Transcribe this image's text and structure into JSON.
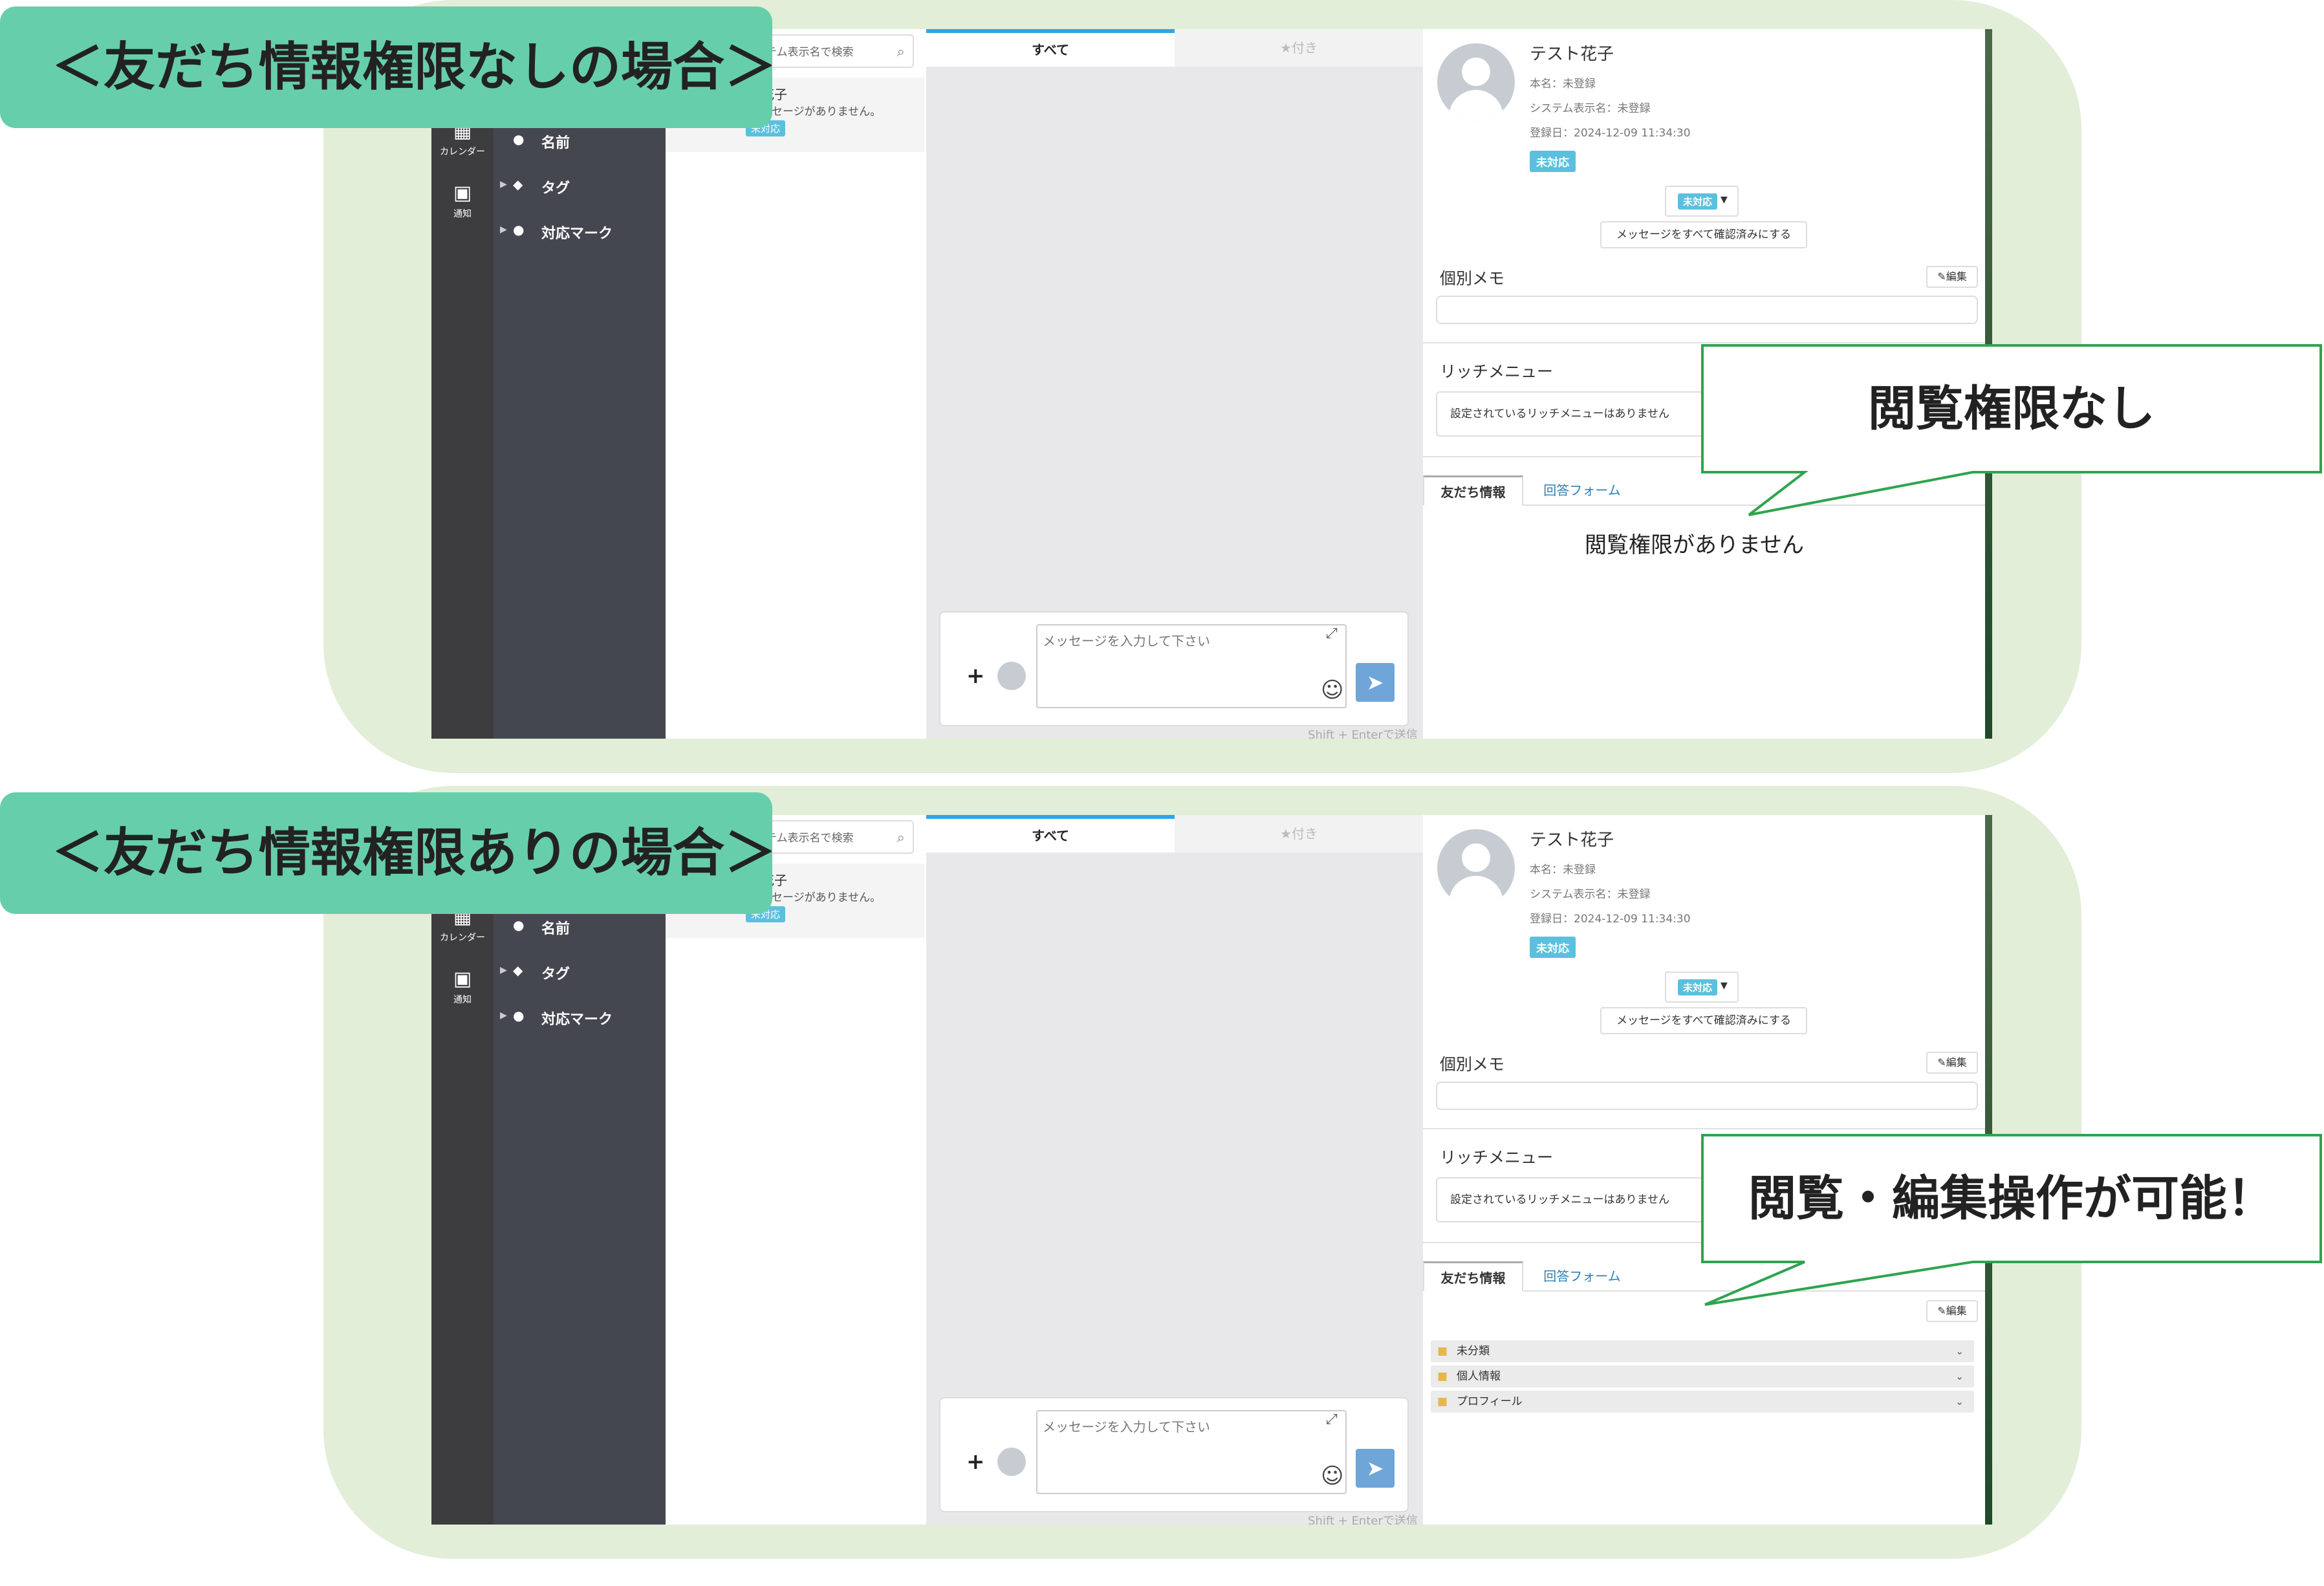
{
  "sidebar": {
    "calendar_label": "カレンダー",
    "notify_label": "通知",
    "menu": [
      {
        "label": "名前",
        "icon": "person-icon"
      },
      {
        "label": "タグ",
        "icon": "tags-icon"
      },
      {
        "label": "対応マーク",
        "icon": "alert-icon"
      }
    ]
  },
  "friend_list": {
    "search_placeholder": "ステム表示名で検索",
    "entry_name": "花子",
    "entry_message": "メッセージがありません。",
    "entry_badge": "未対応"
  },
  "chat": {
    "tab_all": "すべて",
    "tab_starred": "★付き",
    "plus": "+",
    "input_placeholder": "メッセージを入力して下さい",
    "hint": "Shift + Enterで送信"
  },
  "profile": {
    "name": "テスト花子",
    "real_name": "本名：未登録",
    "system_name": "システム表示名：未登録",
    "registered": "登録日：2024-12-09 11:34:30",
    "status_badge": "未対応",
    "read_all_button": "メッセージをすべて確認済みにする",
    "memo_title": "個別メモ",
    "edit_label": "編集",
    "richmenu_title": "リッチメニュー",
    "richmenu_empty": "設定されているリッチメニューはありません",
    "tab_friend_info": "友だち情報",
    "tab_answer_form": "回答フォーム"
  },
  "panels": [
    {
      "banner": "＜友だち情報権限なしの場合＞",
      "callout": "閲覧権限なし",
      "no_permission_text": "閲覧権限がありません"
    },
    {
      "banner": "＜友だち情報権限ありの場合＞",
      "callout": "閲覧・編集操作が可能！",
      "folders": [
        "未分類",
        "個人情報",
        "プロフィール"
      ]
    }
  ],
  "colors": {
    "banner": "#66ceab",
    "panel_bg": "#e2eed8",
    "callout_border": "#2ea44f",
    "badge": "#5bc0de",
    "link": "#2e7fb8"
  }
}
